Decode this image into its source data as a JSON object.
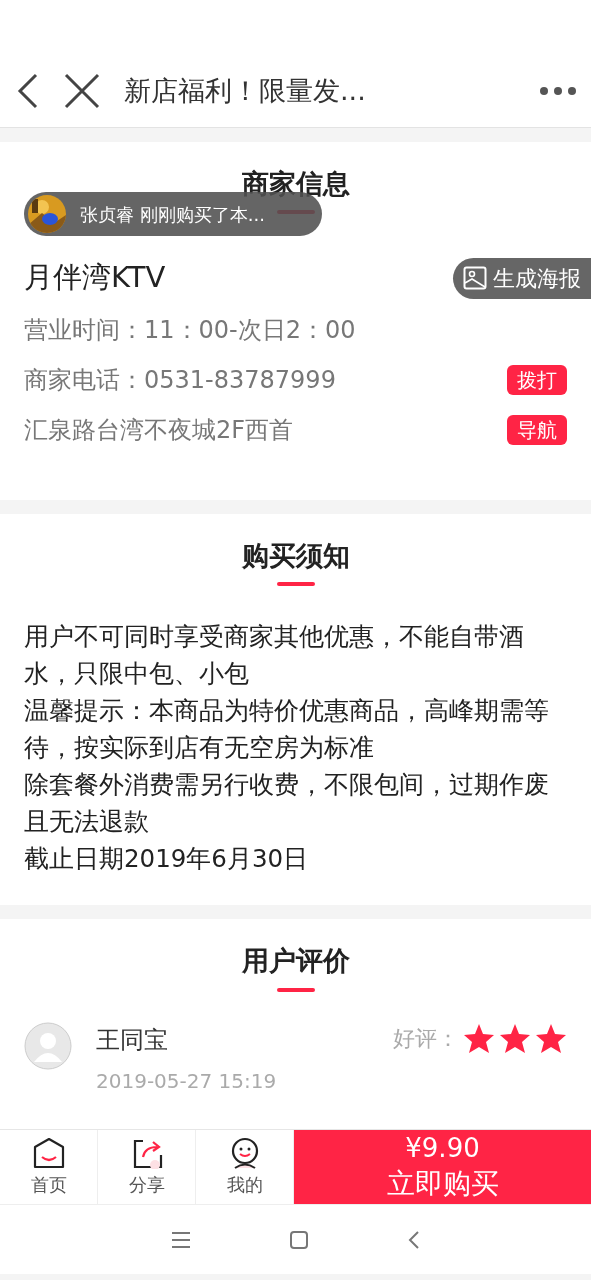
{
  "header": {
    "title": "新店福利！限量发..."
  },
  "toast": {
    "text": "张贞睿 刚刚购买了本..."
  },
  "merchant": {
    "heading": "商家信息",
    "name": "月伴湾KTV",
    "poster_button": "生成海报",
    "rows": [
      {
        "text": "营业时间：11：00-次日2：00"
      },
      {
        "text": "商家电话：0531-83787999",
        "action": "拨打"
      },
      {
        "text": "汇泉路台湾不夜城2F西首",
        "action": "导航"
      }
    ]
  },
  "notice": {
    "heading": "购买须知",
    "lines": [
      "用户不可同时享受商家其他优惠，不能自带酒水，只限中包、小包",
      "温馨提示：本商品为特价优惠商品，高峰期需等待，按实际到店有无空房为标准",
      "除套餐外消费需另行收费，不限包间，过期作废且无法退款",
      "截止日期2019年6月30日"
    ]
  },
  "reviews": {
    "heading": "用户评价",
    "items": [
      {
        "user": "王同宝",
        "time": "2019-05-27 15:19",
        "rating_label": "好评：",
        "stars": 3
      }
    ]
  },
  "tabbar": {
    "items": [
      {
        "label": "首页",
        "kind": "home"
      },
      {
        "label": "分享",
        "kind": "share"
      },
      {
        "label": "我的",
        "kind": "me"
      }
    ],
    "price": "¥9.90",
    "buy": "立即购买"
  }
}
